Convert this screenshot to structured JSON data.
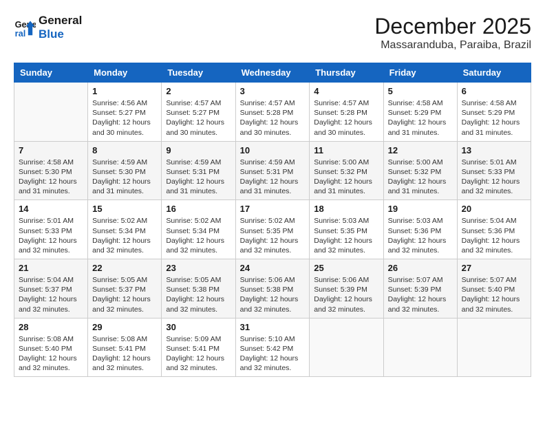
{
  "logo": {
    "line1": "General",
    "line2": "Blue"
  },
  "title": "December 2025",
  "location": "Massaranduba, Paraiba, Brazil",
  "days_of_week": [
    "Sunday",
    "Monday",
    "Tuesday",
    "Wednesday",
    "Thursday",
    "Friday",
    "Saturday"
  ],
  "weeks": [
    [
      {
        "day": "",
        "info": ""
      },
      {
        "day": "1",
        "info": "Sunrise: 4:56 AM\nSunset: 5:27 PM\nDaylight: 12 hours\nand 30 minutes."
      },
      {
        "day": "2",
        "info": "Sunrise: 4:57 AM\nSunset: 5:27 PM\nDaylight: 12 hours\nand 30 minutes."
      },
      {
        "day": "3",
        "info": "Sunrise: 4:57 AM\nSunset: 5:28 PM\nDaylight: 12 hours\nand 30 minutes."
      },
      {
        "day": "4",
        "info": "Sunrise: 4:57 AM\nSunset: 5:28 PM\nDaylight: 12 hours\nand 30 minutes."
      },
      {
        "day": "5",
        "info": "Sunrise: 4:58 AM\nSunset: 5:29 PM\nDaylight: 12 hours\nand 31 minutes."
      },
      {
        "day": "6",
        "info": "Sunrise: 4:58 AM\nSunset: 5:29 PM\nDaylight: 12 hours\nand 31 minutes."
      }
    ],
    [
      {
        "day": "7",
        "info": "Sunrise: 4:58 AM\nSunset: 5:30 PM\nDaylight: 12 hours\nand 31 minutes."
      },
      {
        "day": "8",
        "info": "Sunrise: 4:59 AM\nSunset: 5:30 PM\nDaylight: 12 hours\nand 31 minutes."
      },
      {
        "day": "9",
        "info": "Sunrise: 4:59 AM\nSunset: 5:31 PM\nDaylight: 12 hours\nand 31 minutes."
      },
      {
        "day": "10",
        "info": "Sunrise: 4:59 AM\nSunset: 5:31 PM\nDaylight: 12 hours\nand 31 minutes."
      },
      {
        "day": "11",
        "info": "Sunrise: 5:00 AM\nSunset: 5:32 PM\nDaylight: 12 hours\nand 31 minutes."
      },
      {
        "day": "12",
        "info": "Sunrise: 5:00 AM\nSunset: 5:32 PM\nDaylight: 12 hours\nand 31 minutes."
      },
      {
        "day": "13",
        "info": "Sunrise: 5:01 AM\nSunset: 5:33 PM\nDaylight: 12 hours\nand 32 minutes."
      }
    ],
    [
      {
        "day": "14",
        "info": "Sunrise: 5:01 AM\nSunset: 5:33 PM\nDaylight: 12 hours\nand 32 minutes."
      },
      {
        "day": "15",
        "info": "Sunrise: 5:02 AM\nSunset: 5:34 PM\nDaylight: 12 hours\nand 32 minutes."
      },
      {
        "day": "16",
        "info": "Sunrise: 5:02 AM\nSunset: 5:34 PM\nDaylight: 12 hours\nand 32 minutes."
      },
      {
        "day": "17",
        "info": "Sunrise: 5:02 AM\nSunset: 5:35 PM\nDaylight: 12 hours\nand 32 minutes."
      },
      {
        "day": "18",
        "info": "Sunrise: 5:03 AM\nSunset: 5:35 PM\nDaylight: 12 hours\nand 32 minutes."
      },
      {
        "day": "19",
        "info": "Sunrise: 5:03 AM\nSunset: 5:36 PM\nDaylight: 12 hours\nand 32 minutes."
      },
      {
        "day": "20",
        "info": "Sunrise: 5:04 AM\nSunset: 5:36 PM\nDaylight: 12 hours\nand 32 minutes."
      }
    ],
    [
      {
        "day": "21",
        "info": "Sunrise: 5:04 AM\nSunset: 5:37 PM\nDaylight: 12 hours\nand 32 minutes."
      },
      {
        "day": "22",
        "info": "Sunrise: 5:05 AM\nSunset: 5:37 PM\nDaylight: 12 hours\nand 32 minutes."
      },
      {
        "day": "23",
        "info": "Sunrise: 5:05 AM\nSunset: 5:38 PM\nDaylight: 12 hours\nand 32 minutes."
      },
      {
        "day": "24",
        "info": "Sunrise: 5:06 AM\nSunset: 5:38 PM\nDaylight: 12 hours\nand 32 minutes."
      },
      {
        "day": "25",
        "info": "Sunrise: 5:06 AM\nSunset: 5:39 PM\nDaylight: 12 hours\nand 32 minutes."
      },
      {
        "day": "26",
        "info": "Sunrise: 5:07 AM\nSunset: 5:39 PM\nDaylight: 12 hours\nand 32 minutes."
      },
      {
        "day": "27",
        "info": "Sunrise: 5:07 AM\nSunset: 5:40 PM\nDaylight: 12 hours\nand 32 minutes."
      }
    ],
    [
      {
        "day": "28",
        "info": "Sunrise: 5:08 AM\nSunset: 5:40 PM\nDaylight: 12 hours\nand 32 minutes."
      },
      {
        "day": "29",
        "info": "Sunrise: 5:08 AM\nSunset: 5:41 PM\nDaylight: 12 hours\nand 32 minutes."
      },
      {
        "day": "30",
        "info": "Sunrise: 5:09 AM\nSunset: 5:41 PM\nDaylight: 12 hours\nand 32 minutes."
      },
      {
        "day": "31",
        "info": "Sunrise: 5:10 AM\nSunset: 5:42 PM\nDaylight: 12 hours\nand 32 minutes."
      },
      {
        "day": "",
        "info": ""
      },
      {
        "day": "",
        "info": ""
      },
      {
        "day": "",
        "info": ""
      }
    ]
  ]
}
